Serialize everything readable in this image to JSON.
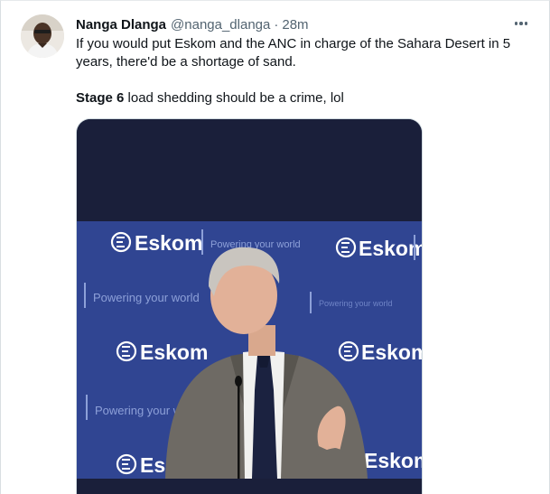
{
  "author": {
    "name": "Nanga Dlanga",
    "handle": "@nanga_dlanga",
    "separator": "·",
    "time": "28m"
  },
  "tweet": {
    "line1": "If you would put Eskom and the ANC in charge of the Sahara Desert in 5 years, there'd be a shortage of sand.",
    "line2_bold": "Stage 6",
    "line2_rest": " load shedding should be a crime, lol"
  },
  "media": {
    "backdrop_brand": "Eskom",
    "backdrop_slogan": "Powering your world",
    "colors": {
      "frame": "#1a1f3a",
      "backdrop": "#2b3f8c",
      "suit": "#6e6a64",
      "tie": "#1b2240"
    }
  },
  "icons": {
    "more": "more-horizontal-icon",
    "brand": "eskom-logo-icon"
  }
}
